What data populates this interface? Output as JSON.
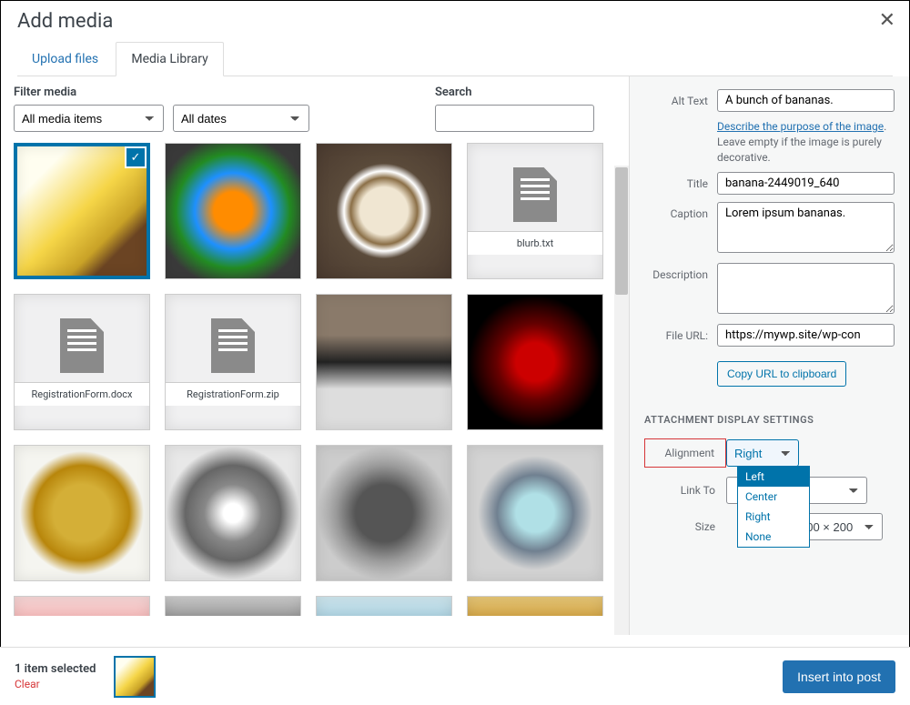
{
  "modal": {
    "title": "Add media"
  },
  "tabs": [
    {
      "label": "Upload files"
    },
    {
      "label": "Media Library"
    }
  ],
  "filters": {
    "filter_label": "Filter media",
    "media_type_value": "All media items",
    "date_value": "All dates",
    "search_label": "Search",
    "search_value": ""
  },
  "media_grid": {
    "file_names": {
      "blurb": "blurb.txt",
      "reg_docx": "RegistrationForm.docx",
      "reg_zip": "RegistrationForm.zip"
    }
  },
  "details": {
    "alt_text_label": "Alt Text",
    "alt_text_value": "A bunch of bananas.",
    "alt_help_link": "Describe the purpose of the image",
    "alt_help_rest": ". Leave empty if the image is purely decorative.",
    "title_label": "Title",
    "title_value": "banana-2449019_640",
    "caption_label": "Caption",
    "caption_value": "Lorem ipsum bananas.",
    "description_label": "Description",
    "description_value": "",
    "file_url_label": "File URL:",
    "file_url_value": "https://mywp.site/wp-con",
    "copy_btn": "Copy URL to clipboard"
  },
  "display_settings": {
    "section_title": "ATTACHMENT DISPLAY SETTINGS",
    "alignment_label": "Alignment",
    "alignment_value": "Right",
    "alignment_options": {
      "o1": "Left",
      "o2": "Center",
      "o3": "Right",
      "o4": "None"
    },
    "link_to_label": "Link To",
    "link_to_value": "",
    "size_label": "Size",
    "size_value": "300 × 200"
  },
  "footer": {
    "selection_text": "1 item selected",
    "clear_text": "Clear",
    "insert_btn": "Insert into post"
  }
}
